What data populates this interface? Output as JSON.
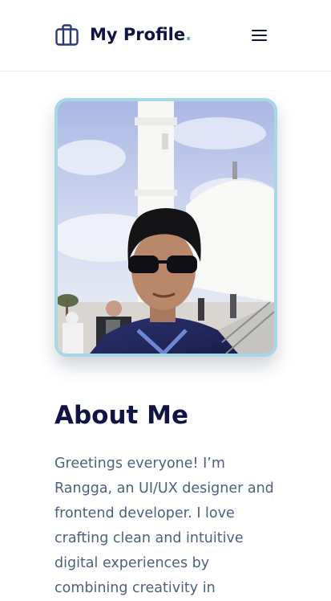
{
  "header": {
    "brand_icon": "briefcase-icon",
    "brand_name": "My Profile",
    "brand_dot": ".",
    "menu_icon": "hamburger-menu-icon"
  },
  "profile_photo": {
    "alt": "Profile photo of Rangga in front of a white mosque"
  },
  "about": {
    "title": "About Me",
    "text": "Greetings everyone! I’m Rangga, an UI/UX designer and frontend developer. I love crafting clean and intuitive digital experiences by combining creativity in"
  },
  "colors": {
    "heading": "#111344",
    "body_text": "#4d6081",
    "accent_border": "#a9d6e3",
    "brand_dot": "#6aa8c4"
  }
}
